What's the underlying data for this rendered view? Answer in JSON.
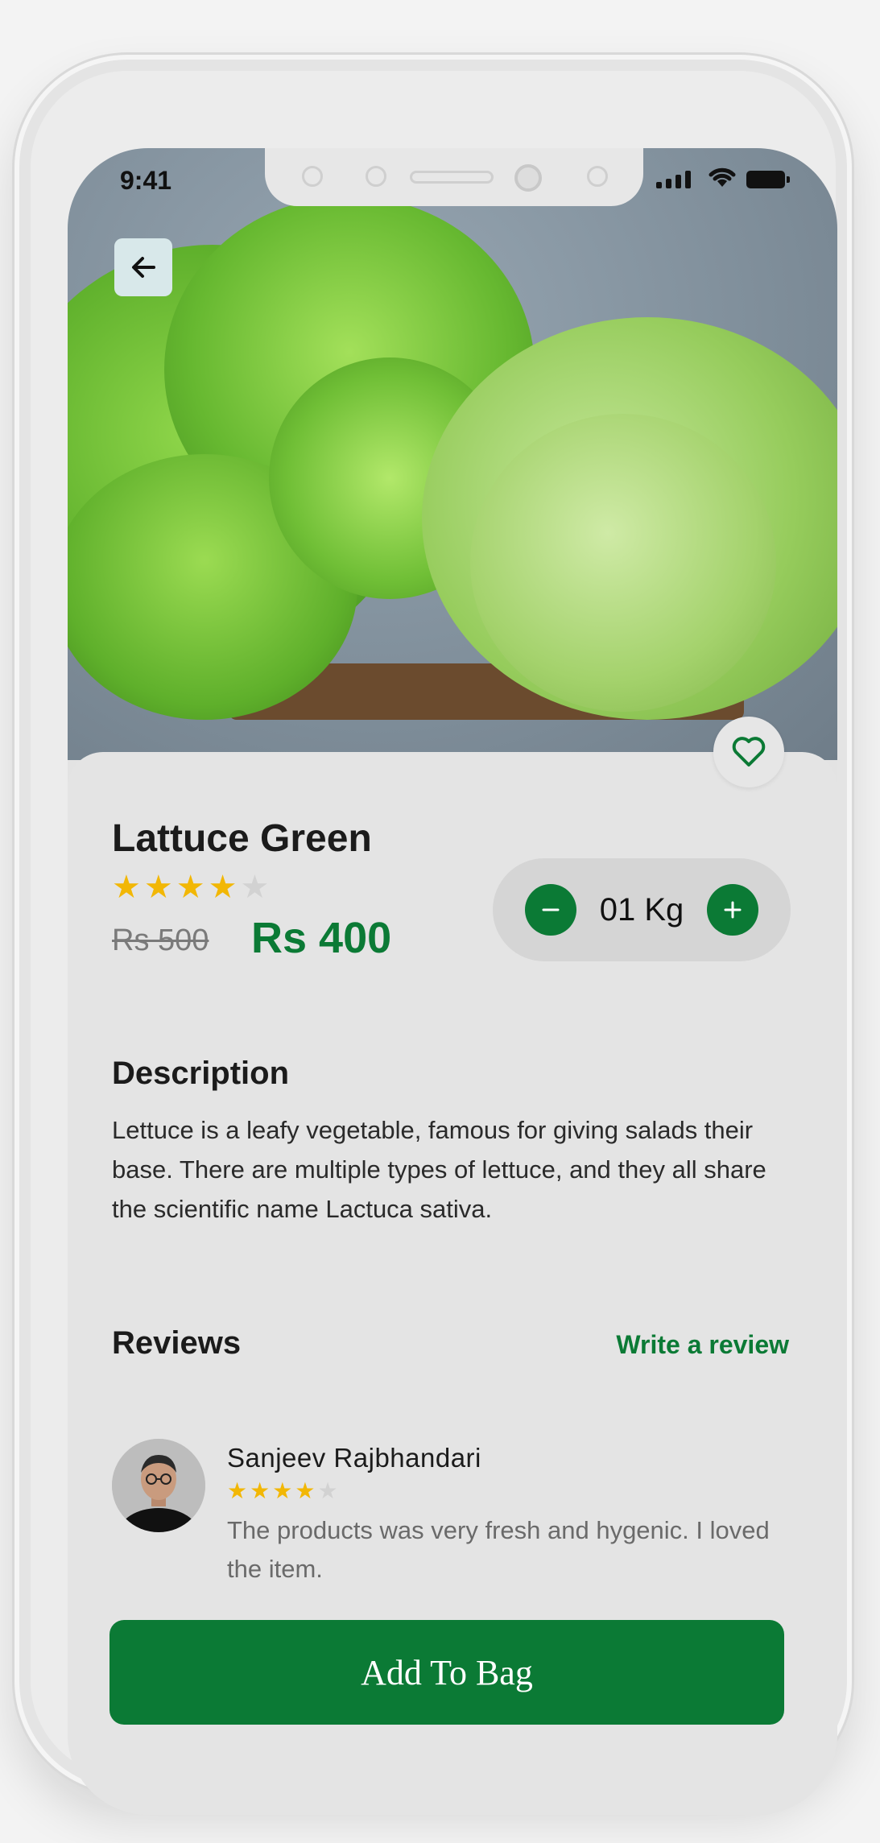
{
  "status_bar": {
    "time": "9:41"
  },
  "product": {
    "name": "Lattuce Green",
    "rating": 4,
    "rating_max": 5,
    "old_price": "Rs 500",
    "price": "Rs 400",
    "quantity": "01 Kg",
    "image_icon": "lettuce-photo"
  },
  "description": {
    "heading": "Description",
    "text": "Lettuce is a leafy vegetable, famous for giving salads their base. There are multiple types of lettuce, and they all share the scientific name Lactuca sativa."
  },
  "reviews": {
    "heading": "Reviews",
    "write_label": "Write a review",
    "items": [
      {
        "name": "Sanjeev Rajbhandari",
        "rating": 4,
        "text": "The products was very fresh and hygenic. I loved the item."
      }
    ]
  },
  "actions": {
    "add_to_bag": "Add To Bag"
  },
  "colors": {
    "accent": "#0b7a35",
    "star": "#f2b705"
  }
}
